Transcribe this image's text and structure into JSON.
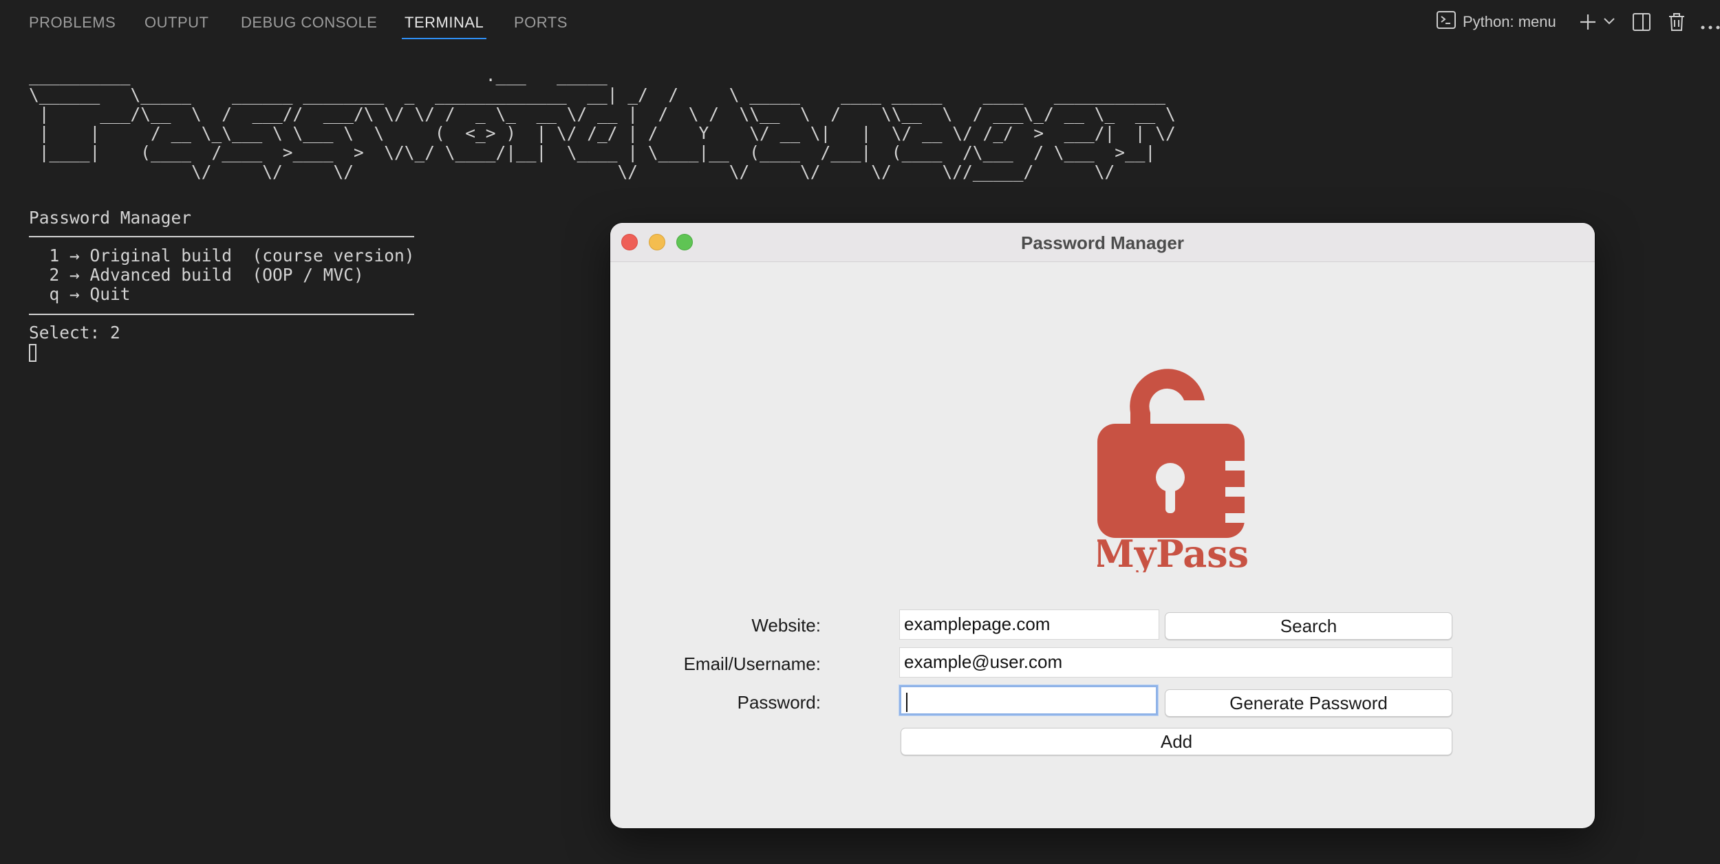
{
  "panel": {
    "tabs": [
      {
        "label": "PROBLEMS"
      },
      {
        "label": "OUTPUT"
      },
      {
        "label": "DEBUG CONSOLE"
      },
      {
        "label": "TERMINAL",
        "active": true
      },
      {
        "label": "PORTS"
      }
    ],
    "terminal_selector": "Python: menu",
    "icons": [
      "terminal-icon",
      "plus-icon",
      "chevron-down-icon",
      "split-icon",
      "trash-icon",
      "more-icon"
    ]
  },
  "terminal": {
    "ascii_banner": "__________                                   .___   _____\n\\______   \\_____    ______ ________  _  _____________  __| _/  /     \\ _____    ____ _____    ____   ___________\n |     ___/\\__  \\  /  ___//  ___/\\ \\/ \\/ /  _ \\_  __ \\/ __ |  /  \\ /  \\\\__  \\  /    \\\\__  \\  / ___\\_/ __ \\_  __ \\\n |    |     / __ \\_\\___ \\ \\___ \\  \\     (  <_> )  | \\/ /_/ | /    Y    \\/ __ \\|   |  \\/ __ \\/ /_/  >  ___/|  | \\/\n |____|    (____  /____  >____  >  \\/\\_/ \\____/|__|  \\____ | \\____|__  (____  /___|  (____  /\\___  / \\___  >__|\n                \\/     \\/     \\/                          \\/         \\/     \\/     \\/     \\//_____/      \\/",
    "menu_title": "Password Manager",
    "menu_items": [
      "  1 → Original build  (course version)",
      "  2 → Advanced build  (OOP / MVC)",
      "  q → Quit"
    ],
    "prompt": "Select: 2"
  },
  "window": {
    "title": "Password Manager",
    "logo_text": "MyPass",
    "form": {
      "website_label": "Website:",
      "website_value": "examplepage.com",
      "email_label": "Email/Username:",
      "email_value": "example@user.com",
      "password_label": "Password:",
      "password_value": "",
      "search_button": "Search",
      "generate_button": "Generate Password",
      "add_button": "Add"
    },
    "colors": {
      "logo": "#c85243"
    }
  }
}
